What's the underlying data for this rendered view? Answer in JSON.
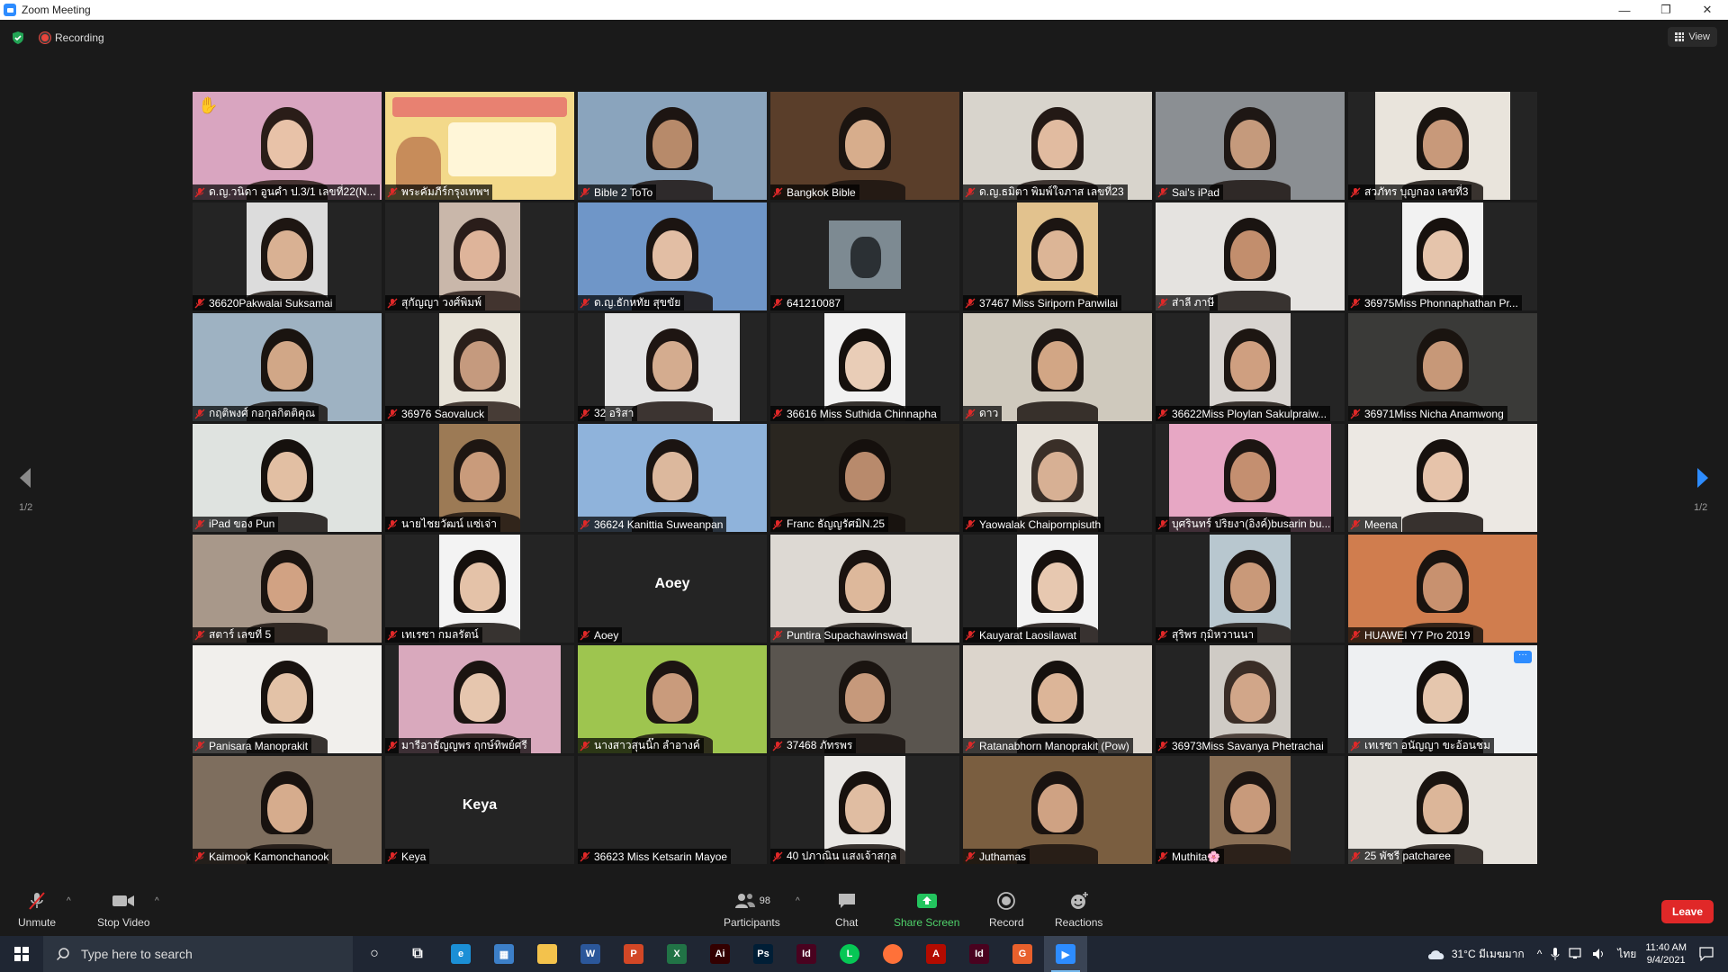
{
  "window": {
    "title": "Zoom Meeting",
    "minimize": "—",
    "restore": "❐",
    "close": "✕"
  },
  "status": {
    "recording_label": "Recording",
    "view_label": "View"
  },
  "gallery": {
    "page_indicator_left": "1/2",
    "page_indicator_right": "1/2",
    "tiles": [
      {
        "name": "ด.ญ.วนิดา อูนคำ ป.3/1 เลขที่22(N...",
        "style": "full",
        "bg": "#d9a5c0",
        "skin": "#e8c2a8",
        "hair": "#2a1d18",
        "hand": true
      },
      {
        "name": "พระคัมภีร์กรุงเทพฯ",
        "style": "full",
        "bg": "#f3d98a",
        "poster": true
      },
      {
        "name": "Bible 2 ToTo",
        "style": "full",
        "bg": "#8aa4bd",
        "skin": "#b78a6a",
        "hair": "#1d1512"
      },
      {
        "name": "Bangkok Bible",
        "style": "full",
        "bg": "#5a3e2a",
        "skin": "#d7ad8c",
        "hair": "#1b1410",
        "active": true
      },
      {
        "name": "ด.ญ.ธมิตา พิมพ์ใจภาส เลขที่23",
        "style": "full",
        "bg": "#d8d4cc",
        "skin": "#e1bba0",
        "hair": "#231915"
      },
      {
        "name": "Sai's iPad",
        "style": "full",
        "bg": "#8b8f93",
        "skin": "#c59a7c",
        "hair": "#1e1714"
      },
      {
        "name": "สวภัทร บุญกอง เลขที่3",
        "style": "center",
        "bg": "#e9e4dc",
        "skin": "#c8997a",
        "hair": "#1a1410"
      },
      {
        "name": "36620Pakwalai Suksamai",
        "style": "narrow",
        "bg": "#dcdcdc",
        "skin": "#d9b193",
        "hair": "#1e1612"
      },
      {
        "name": "สุกัญญา วงศ์พิมพ์",
        "style": "narrow",
        "bg": "#c9b7aa",
        "skin": "#deb49a",
        "hair": "#2a1d1a"
      },
      {
        "name": "ด.ญ.ธักหทัย สุขขัย",
        "style": "full",
        "bg": "#6f96c8",
        "skin": "#e2bea4",
        "hair": "#1b1411"
      },
      {
        "name": "641210087",
        "style": "dark",
        "bg": "#242424",
        "thumb": true
      },
      {
        "name": "37467 Miss Siriporn Panwilai",
        "style": "narrow",
        "bg": "#e2c28e",
        "skin": "#dcb596",
        "hair": "#1c1512"
      },
      {
        "name": "ส่าลี ภาษี",
        "style": "full",
        "bg": "#e5e3e0",
        "skin": "#c28e6d",
        "hair": "#1a1411"
      },
      {
        "name": "36975Miss Phonnaphathan Pr...",
        "style": "narrow",
        "bg": "#f2f2f2",
        "skin": "#e5c4ab",
        "hair": "#17110e"
      },
      {
        "name": "กฤติพงศ์ กอกุลกิตติคุณ",
        "style": "full",
        "bg": "#9eb2c2",
        "skin": "#d1a787",
        "hair": "#1a1410"
      },
      {
        "name": "36976 Saovaluck",
        "style": "narrow",
        "bg": "#e7e2d7",
        "skin": "#c59a7e",
        "hair": "#2a1f1a"
      },
      {
        "name": "32 อริสา",
        "style": "center",
        "bg": "#e3e3e3",
        "skin": "#d4ac8f",
        "hair": "#1e1512"
      },
      {
        "name": "36616 Miss Suthida Chinnapha",
        "style": "narrow",
        "bg": "#f1f1f1",
        "skin": "#e9cdb7",
        "hair": "#15100d"
      },
      {
        "name": "ดาว",
        "style": "full",
        "bg": "#cfc9bd",
        "skin": "#d2a685",
        "hair": "#1c1512"
      },
      {
        "name": "36622Miss Ploylan Sakulpraiw...",
        "style": "narrow",
        "bg": "#d8d4d0",
        "skin": "#cf9f80",
        "hair": "#1d1612"
      },
      {
        "name": "36971Miss Nicha Anamwong",
        "style": "full",
        "bg": "#3a3a38",
        "skin": "#c79878",
        "hair": "#1a1410"
      },
      {
        "name": "iPad ของ Pun",
        "style": "full",
        "bg": "#dfe3e0",
        "skin": "#e2bfa3",
        "hair": "#16110e"
      },
      {
        "name": "นายไชยวัฒน์ แซ่เจ่า",
        "style": "narrow",
        "bg": "#9c7a55",
        "skin": "#c99b7b",
        "hair": "#1e1612"
      },
      {
        "name": "36624 Kanittia Suweanpan",
        "style": "full",
        "bg": "#8fb3db",
        "skin": "#dcb89d",
        "hair": "#1b1411"
      },
      {
        "name": "Franc ธัญญรัศมิN.25",
        "style": "full",
        "bg": "#2a2620",
        "skin": "#b88a6c",
        "hair": "#15100d"
      },
      {
        "name": "Yaowalak Chaipornpisuth",
        "style": "narrow",
        "bg": "#e6e1d9",
        "skin": "#d7b094",
        "hair": "#3a2f28"
      },
      {
        "name": "บุศรินทร์ ปริยงา(อิงค์)busarin bu...",
        "style": "mid",
        "bg": "#e7a7c4",
        "skin": "#c48f70",
        "hair": "#1c1512"
      },
      {
        "name": "Meena",
        "style": "full",
        "bg": "#ece8e3",
        "skin": "#e6c3aa",
        "hair": "#17110e"
      },
      {
        "name": "สตาร์ เลขที่ 5",
        "style": "full",
        "bg": "#a8988a",
        "skin": "#d1a283",
        "hair": "#1b1410"
      },
      {
        "name": "เทเรซา กมลรัตน์",
        "style": "narrow",
        "bg": "#f3f3f3",
        "skin": "#e4c2a8",
        "hair": "#15100d"
      },
      {
        "name": "Aoey",
        "style": "placeholder",
        "bg": "#242424",
        "placeholder": "Aoey"
      },
      {
        "name": "Puntira Supachawinswad",
        "style": "full",
        "bg": "#ddd9d3",
        "skin": "#ddb89b",
        "hair": "#1a1310"
      },
      {
        "name": "Kauyarat Laosilawat",
        "style": "narrow",
        "bg": "#f2f2f2",
        "skin": "#e7c8b0",
        "hair": "#17110e"
      },
      {
        "name": "สุริพร กุมิหวานนา",
        "style": "narrow",
        "bg": "#b8c7cf",
        "skin": "#c99979",
        "hair": "#1c1512"
      },
      {
        "name": "HUAWEI Y7 Pro 2019",
        "style": "full",
        "bg": "#d07d4e",
        "skin": "#c8916f",
        "hair": "#1a1410"
      },
      {
        "name": "Panisara Manoprakit",
        "style": "full",
        "bg": "#f1efec",
        "skin": "#e3c2a7",
        "hair": "#18120f"
      },
      {
        "name": "มารีอาธัญญพร ฤกษ์ทิพย์ศรี",
        "style": "mid",
        "bg": "#d9a9bd",
        "skin": "#e6c6ae",
        "hair": "#1b1411"
      },
      {
        "name": "นางสาวสุนนิ๊ก ลำอางค์",
        "style": "full",
        "bg": "#9ec54f",
        "skin": "#c99b7c",
        "hair": "#1c1512"
      },
      {
        "name": "37468 ภัทรพร",
        "style": "full",
        "bg": "#5a554f",
        "skin": "#c6997b",
        "hair": "#1a1410"
      },
      {
        "name": "Ratanabhorn Manoprakit (Pow)",
        "style": "full",
        "bg": "#dcd5cc",
        "skin": "#dcb598",
        "hair": "#16110e"
      },
      {
        "name": "36973Miss Savanya Phetrachai",
        "style": "narrow",
        "bg": "#cfcbc5",
        "skin": "#d1a689",
        "hair": "#3a2d26"
      },
      {
        "name": "เทเรซา อนัญญา ขะอ้อนชม",
        "style": "full",
        "bg": "#eef0f2",
        "skin": "#e5c6ad",
        "hair": "#15100d",
        "more": true
      },
      {
        "name": "Kaimook Kamonchanook",
        "style": "full",
        "bg": "#7e6e5e",
        "skin": "#d6ac8d",
        "hair": "#18120f"
      },
      {
        "name": "Keya",
        "style": "placeholder",
        "bg": "#242424",
        "placeholder": "Keya"
      },
      {
        "name": "36623 Miss Ketsarin Mayoe",
        "style": "dark",
        "bg": "#242424"
      },
      {
        "name": "40 ปภาณิน แสงเจ้าสกุล",
        "style": "narrow",
        "bg": "#e9e7e4",
        "skin": "#e0bda2",
        "hair": "#17110e"
      },
      {
        "name": "Juthamas",
        "style": "full",
        "bg": "#7a5e40",
        "skin": "#cfa283",
        "hair": "#1a1310"
      },
      {
        "name": "Muthita🌸",
        "style": "narrow",
        "bg": "#8a6f55",
        "skin": "#c89a7b",
        "hair": "#1b1411"
      },
      {
        "name": "25 พัชรี patcharee",
        "style": "full",
        "bg": "#e6e2dc",
        "skin": "#dcb699",
        "hair": "#1a1410"
      }
    ]
  },
  "toolbar": {
    "unmute": "Unmute",
    "stop_video": "Stop Video",
    "participants": "Participants",
    "participants_count": "98",
    "chat": "Chat",
    "share_screen": "Share Screen",
    "record": "Record",
    "reactions": "Reactions",
    "leave": "Leave"
  },
  "taskbar": {
    "search_placeholder": "Type here to search",
    "weather": "31°C มีเมฆมาก",
    "lang": "ไทย",
    "time": "11:40 AM",
    "date": "9/4/2021",
    "apps": [
      {
        "name": "cortana-icon",
        "glyph": "○",
        "color": "transparent"
      },
      {
        "name": "task-view-icon",
        "glyph": "⧉",
        "color": "transparent"
      },
      {
        "name": "edge-icon",
        "glyph": "e",
        "color": "#1b8fd6"
      },
      {
        "name": "calculator-icon",
        "glyph": "▦",
        "color": "#3c7fc8"
      },
      {
        "name": "file-explorer-icon",
        "glyph": "",
        "color": "#f3c24c"
      },
      {
        "name": "word-icon",
        "glyph": "W",
        "color": "#2b579a"
      },
      {
        "name": "powerpoint-icon",
        "glyph": "P",
        "color": "#d24726"
      },
      {
        "name": "excel-icon",
        "glyph": "X",
        "color": "#217346"
      },
      {
        "name": "illustrator-icon",
        "glyph": "Ai",
        "color": "#330000"
      },
      {
        "name": "photoshop-icon",
        "glyph": "Ps",
        "color": "#001e36"
      },
      {
        "name": "indesign-icon",
        "glyph": "Id",
        "color": "#49021f"
      },
      {
        "name": "line-icon",
        "glyph": "L",
        "color": "#06c755"
      },
      {
        "name": "firefox-icon",
        "glyph": "",
        "color": "#ff7139"
      },
      {
        "name": "acrobat-icon",
        "glyph": "A",
        "color": "#b30b00"
      },
      {
        "name": "indesign-alt-icon",
        "glyph": "Id",
        "color": "#49021f"
      },
      {
        "name": "grammarly-icon",
        "glyph": "G",
        "color": "#e8602c"
      },
      {
        "name": "zoom-icon",
        "glyph": "▶",
        "color": "#2d8cff",
        "active": true
      }
    ]
  }
}
